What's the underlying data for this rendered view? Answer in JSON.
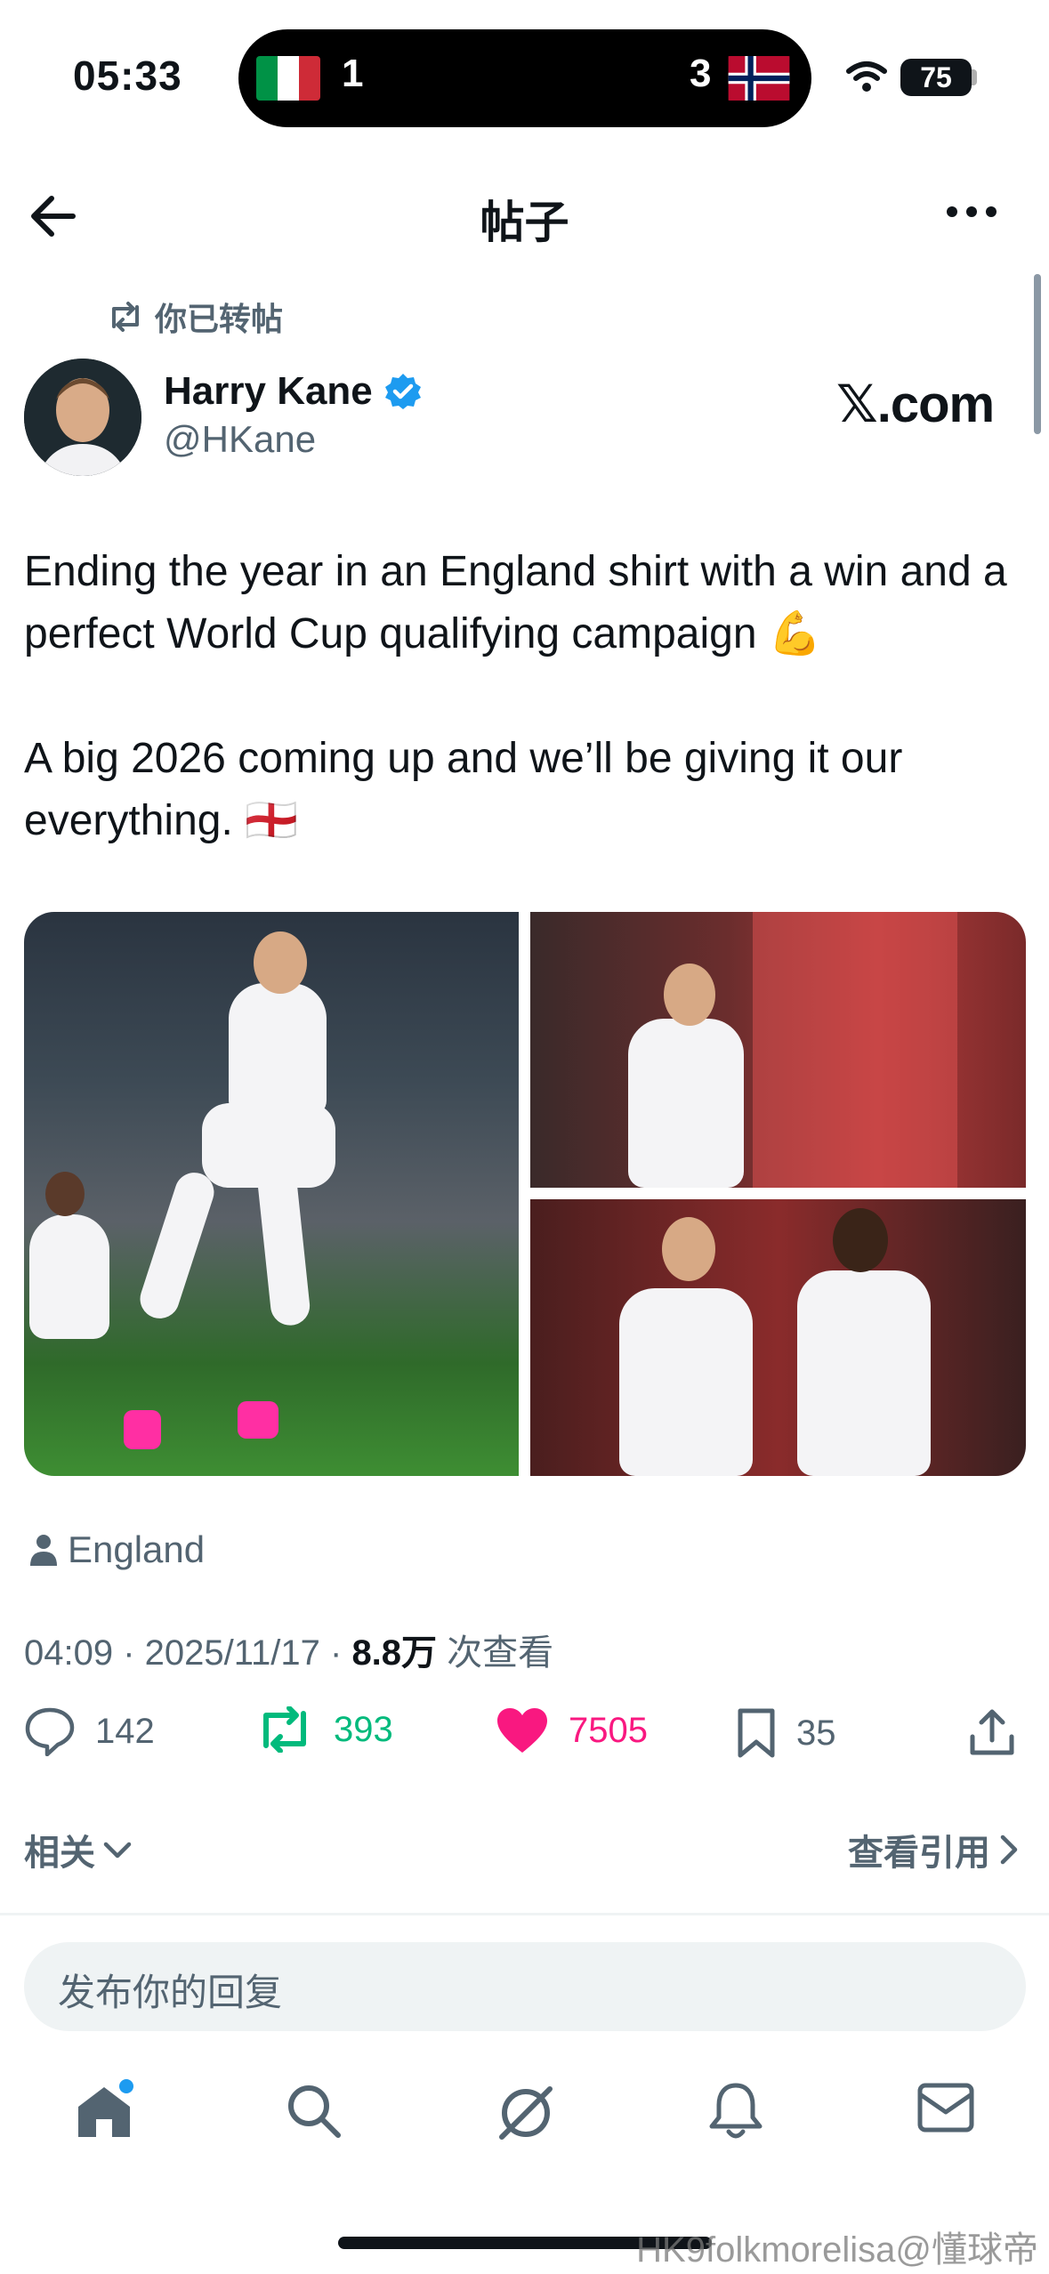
{
  "status_bar": {
    "time": "05:33",
    "live_score": {
      "home_score": "1",
      "away_score": "3"
    },
    "battery": "75"
  },
  "header": {
    "title": "帖子"
  },
  "repost": {
    "label": "你已转帖"
  },
  "post": {
    "author_name": "Harry Kane",
    "handle": "@HKane",
    "source_logo": "𝕏.com",
    "text_p1": "Ending the year in an England shirt with a win and a perfect World Cup qualifying campaign 💪",
    "text_p2": "A big 2026 coming up and we’ll be giving it our everything. 🏴󠁧󠁢󠁥󠁮󠁧󠁿",
    "location": "England",
    "time": "04:09",
    "date": "2025/11/17",
    "views_count": "8.8万",
    "views_label": "次查看"
  },
  "actions": {
    "replies": "142",
    "reposts": "393",
    "likes": "7505",
    "bookmarks": "35"
  },
  "related_label": "相关",
  "quotes_label": "查看引用",
  "reply_placeholder": "发布你的回复",
  "watermark": "HK9folkmorelisa@懂球帝",
  "colors": {
    "repost_green": "#00ba7c",
    "like_pink": "#f91880",
    "verified_blue": "#1d9bf0",
    "secondary_text": "#536471"
  }
}
